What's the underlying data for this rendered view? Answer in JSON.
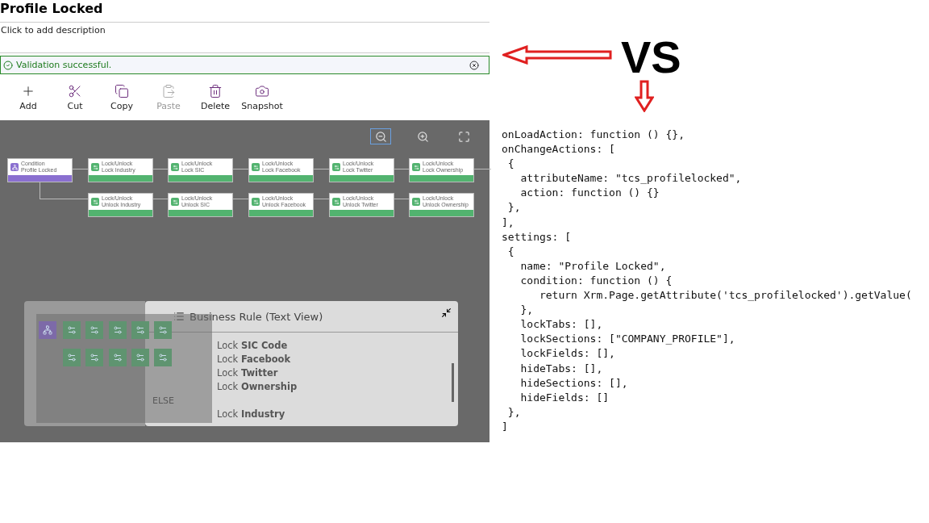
{
  "title": "Profile Locked",
  "description": {
    "placeholder": "Click to add description"
  },
  "validation": {
    "message": "Validation successful."
  },
  "toolbar": [
    {
      "kind": "add",
      "label": "Add",
      "disabled": false
    },
    {
      "kind": "cut",
      "label": "Cut",
      "disabled": false
    },
    {
      "kind": "copy",
      "label": "Copy",
      "disabled": false
    },
    {
      "kind": "paste",
      "label": "Paste",
      "disabled": true
    },
    {
      "kind": "delete",
      "label": "Delete",
      "disabled": false
    },
    {
      "kind": "snapshot",
      "label": "Snapshot",
      "disabled": false
    }
  ],
  "canvas": {
    "rows": [
      [
        {
          "kind": "condition",
          "type": "Condition",
          "name": "Profile Locked"
        },
        {
          "kind": "action",
          "type": "Lock/Unlock",
          "name": "Lock Industry"
        },
        {
          "kind": "action",
          "type": "Lock/Unlock",
          "name": "Lock SIC"
        },
        {
          "kind": "action",
          "type": "Lock/Unlock",
          "name": "Lock Facebook"
        },
        {
          "kind": "action",
          "type": "Lock/Unlock",
          "name": "Lock Twitter"
        },
        {
          "kind": "action",
          "type": "Lock/Unlock",
          "name": "Lock Ownership"
        }
      ],
      [
        "",
        {
          "kind": "action",
          "type": "Lock/Unlock",
          "name": "Unlock Industry"
        },
        {
          "kind": "action",
          "type": "Lock/Unlock",
          "name": "Unlock SIC"
        },
        {
          "kind": "action",
          "type": "Lock/Unlock",
          "name": "Unlock Facebook"
        },
        {
          "kind": "action",
          "type": "Lock/Unlock",
          "name": "Unlock Twitter"
        },
        {
          "kind": "action",
          "type": "Lock/Unlock",
          "name": "Unlock Ownership"
        }
      ]
    ]
  },
  "text_view": {
    "title": "Business Rule (Text View)",
    "else_label": "ELSE",
    "lines": [
      {
        "kind": "rule",
        "text": "Lock **SIC Code**"
      },
      {
        "kind": "rule",
        "text": "Lock **Facebook**"
      },
      {
        "kind": "rule",
        "text": "Lock **Twitter**"
      },
      {
        "kind": "rule",
        "text": "Lock **Ownership**"
      },
      {
        "kind": "gap"
      },
      {
        "kind": "rule",
        "text": "Lock **Industry**"
      }
    ]
  },
  "comparison": {
    "vs_label": "VS",
    "code_lines": [
      "onLoadAction: function () {},",
      "onChangeActions: [",
      " {",
      "   attributeName: \"tcs_profilelocked\",",
      "   action: function () {}",
      " },",
      "],",
      "settings: [",
      " {",
      "   name: \"Profile Locked\",",
      "   condition: function () {",
      "      return Xrm.Page.getAttribute('tcs_profilelocked').getValue(",
      "   },",
      "   lockTabs: [],",
      "   lockSections: [\"COMPANY_PROFILE\"],",
      "   lockFields: [],",
      "   hideTabs: [],",
      "   hideSections: [],",
      "   hideFields: []",
      " },",
      "]"
    ]
  }
}
